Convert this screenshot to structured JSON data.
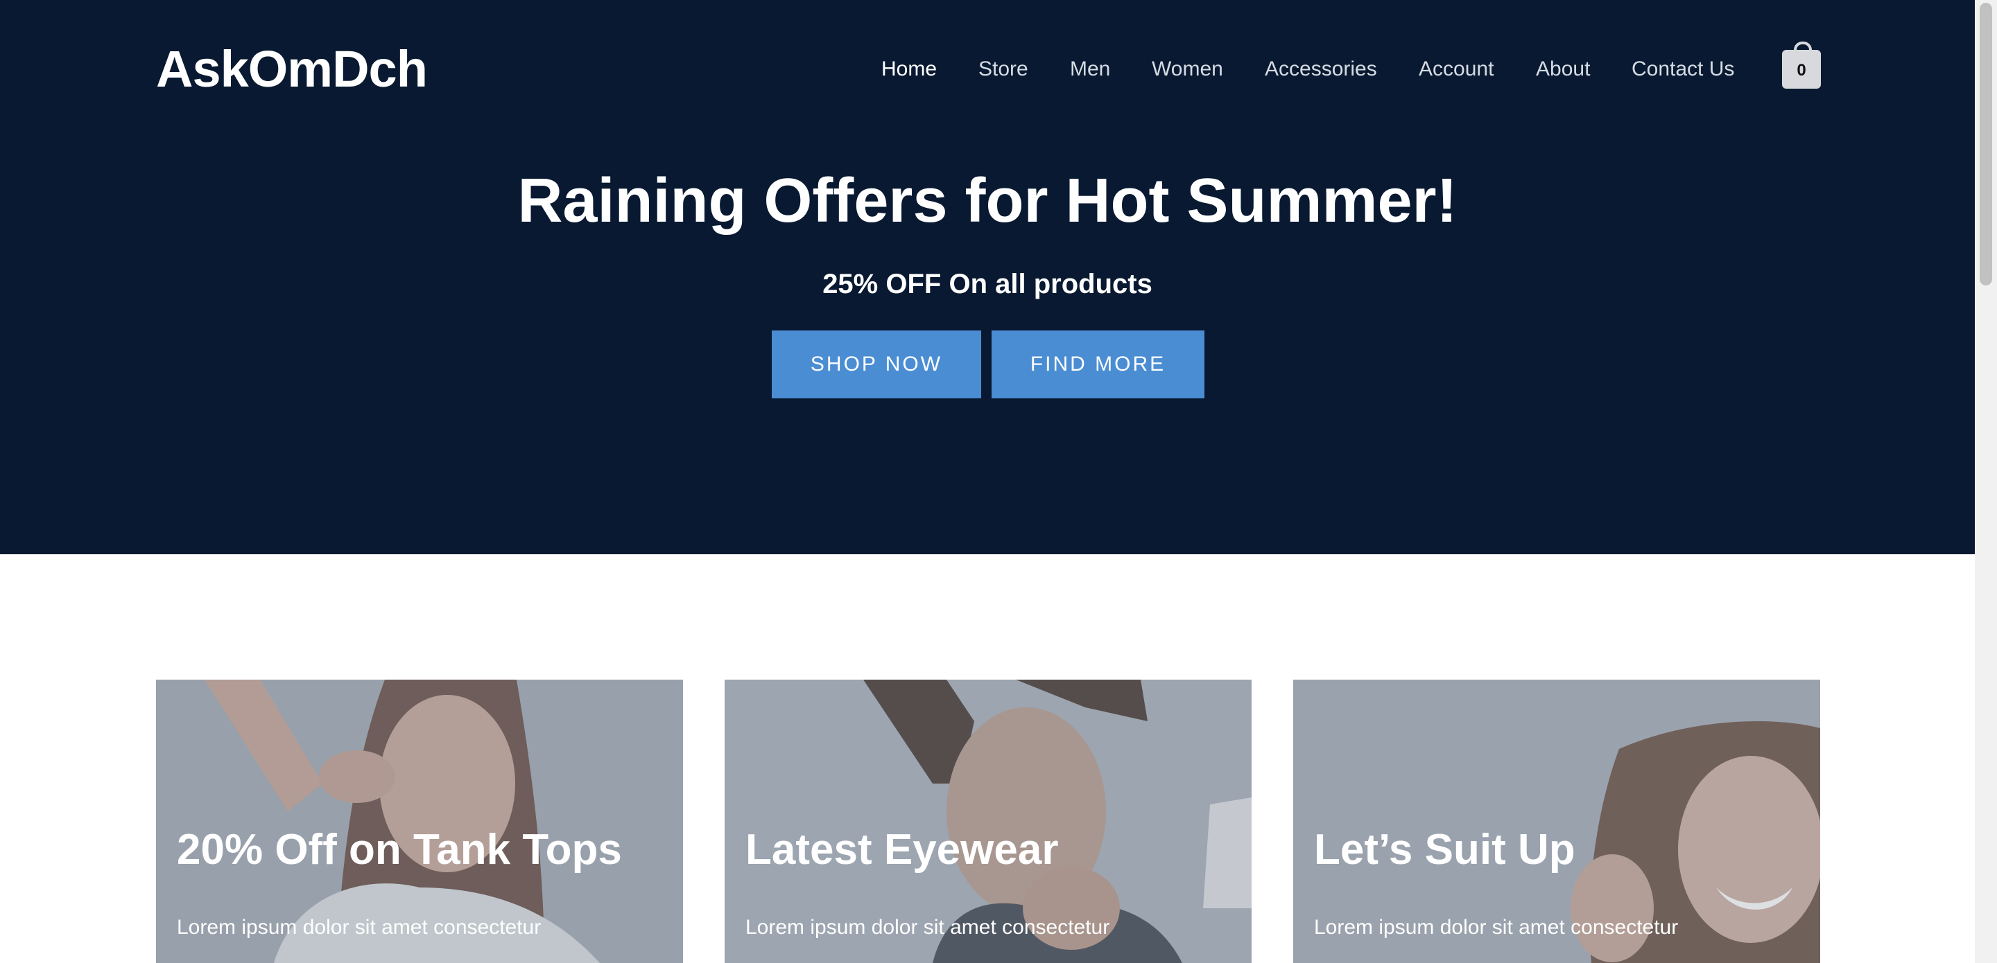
{
  "brand": "AskOmDch",
  "nav": {
    "items": [
      {
        "label": "Home",
        "active": true
      },
      {
        "label": "Store",
        "active": false
      },
      {
        "label": "Men",
        "active": false
      },
      {
        "label": "Women",
        "active": false
      },
      {
        "label": "Accessories",
        "active": false
      },
      {
        "label": "Account",
        "active": false
      },
      {
        "label": "About",
        "active": false
      },
      {
        "label": "Contact Us",
        "active": false
      }
    ],
    "cart_count": "0",
    "cart_icon": "shopping-bag-icon"
  },
  "hero": {
    "title": "Raining Offers for Hot Summer!",
    "subtitle": "25% OFF On all products",
    "shop_button": "SHOP NOW",
    "find_button": "FIND MORE"
  },
  "cards": [
    {
      "title": "20% Off on Tank Tops",
      "text": "Lorem ipsum dolor sit amet consectetur"
    },
    {
      "title": "Latest Eyewear",
      "text": "Lorem ipsum dolor sit amet consectetur"
    },
    {
      "title": "Let’s Suit Up",
      "text": "Lorem ipsum dolor sit amet consectetur"
    }
  ],
  "colors": {
    "hero_background": "#081931",
    "button": "#4a8dd3",
    "cart_badge": "#d7d9dc"
  }
}
